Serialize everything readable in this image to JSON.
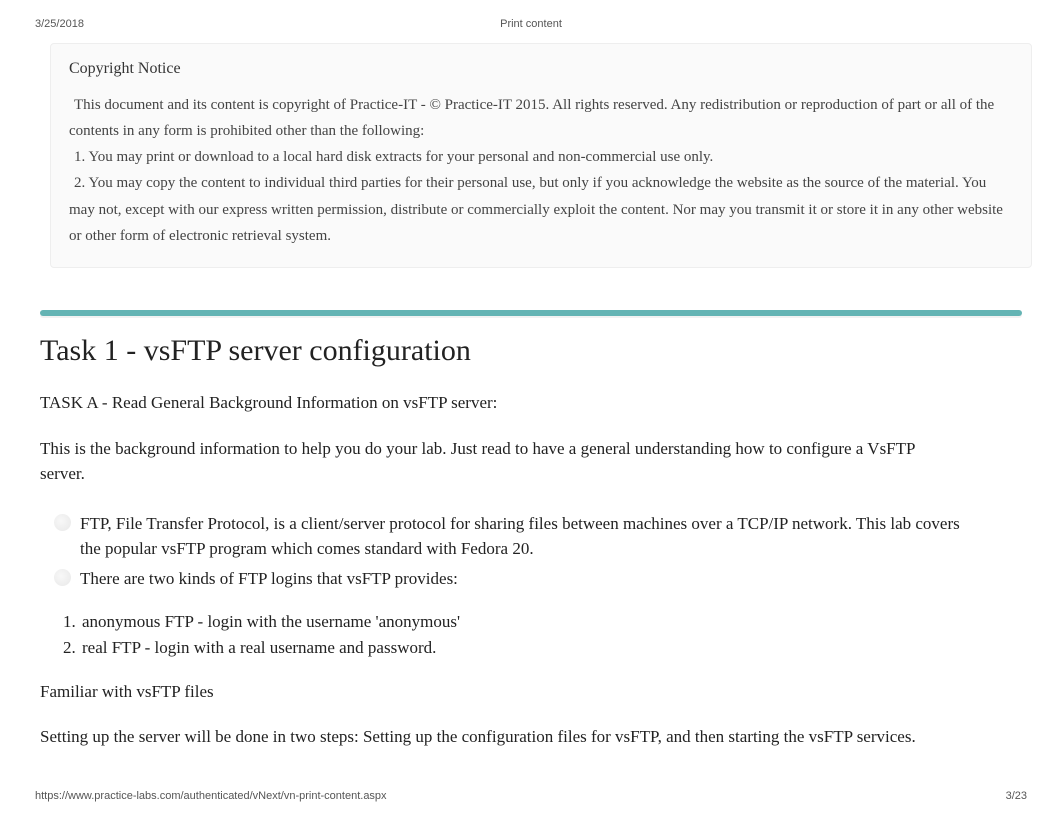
{
  "header": {
    "date": "3/25/2018",
    "title": "Print content"
  },
  "copyright": {
    "heading": "Copyright Notice",
    "intro": " This document and its content is copyright of Practice-IT - © Practice-IT 2015. All rights reserved. Any redistribution or reproduction of part or all of the contents in any form is prohibited other than the following:",
    "item1": " 1. You may print or download to a local hard disk extracts for your personal and non-commercial use only.",
    "item2": " 2. You may copy the content to individual third parties for their personal use, but only if you acknowledge the website as the source of the material. You may not, except with our express written permission, distribute or commercially exploit the content. Nor may you transmit it or store it in any other website or other form of electronic retrieval system."
  },
  "main": {
    "heading": "Task 1 - vsFTP server configuration",
    "task_label": "TASK A - Read General Background Information on vsFTP server:",
    "intro_text": "This is the background information to help you do your lab. Just read to have a general understanding how to configure a VsFTP server.",
    "bullets": {
      "b1": "FTP, File Transfer Protocol, is a client/server protocol for sharing files between machines over a TCP/IP network. This lab covers the popular vsFTP program which comes standard with Fedora 20.",
      "b2": "There are two kinds of FTP logins that vsFTP provides:"
    },
    "numbered": {
      "n1": "anonymous FTP - login with the username 'anonymous'",
      "n2": "real FTP - login with a real username and password."
    },
    "files_label": "Familiar with vsFTP files",
    "setup_text": "Setting up the server will be done in two steps: Setting up the configuration files for vsFTP, and then starting the vsFTP services."
  },
  "footer": {
    "url": "https://www.practice-labs.com/authenticated/vNext/vn-print-content.aspx",
    "page": "3/23"
  }
}
